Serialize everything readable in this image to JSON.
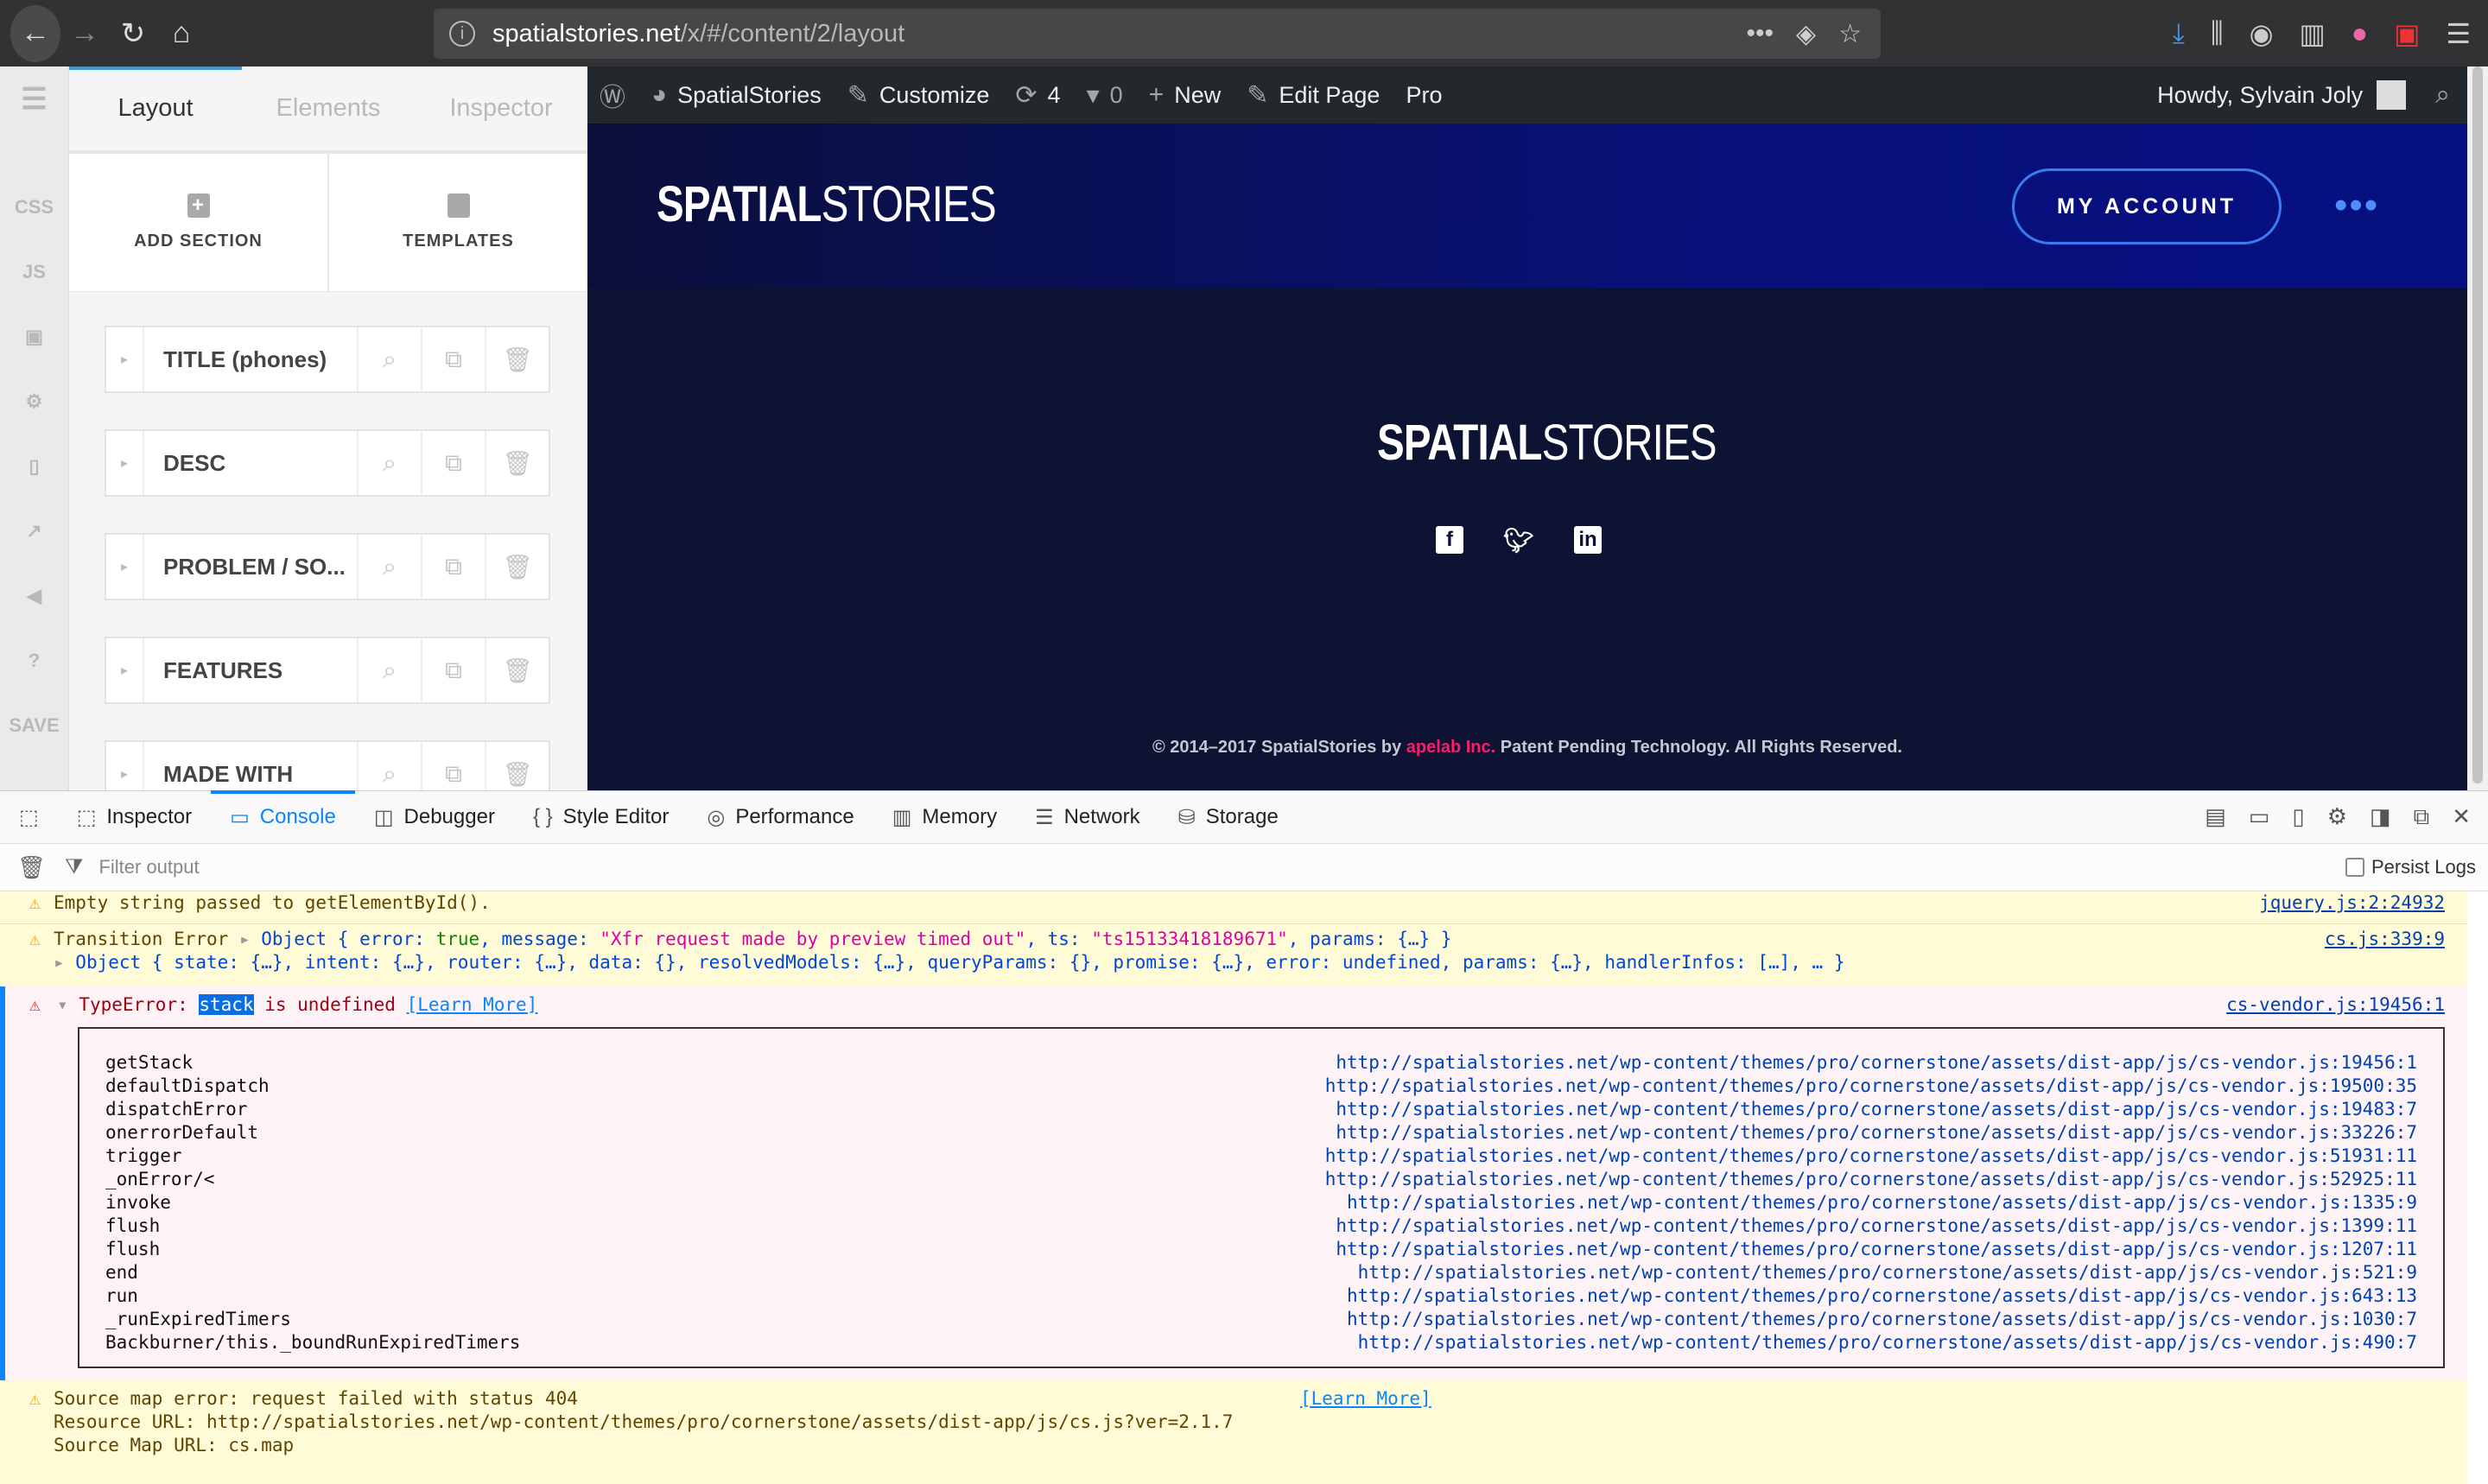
{
  "browser": {
    "url_host": "spatialstories.net",
    "url_path": "/x/#/content/2/layout"
  },
  "rail": {
    "items": [
      "CSS",
      "JS",
      "SAVE"
    ]
  },
  "builder": {
    "tabs": [
      "Layout",
      "Elements",
      "Inspector"
    ],
    "add_section": "ADD SECTION",
    "templates": "TEMPLATES",
    "sections": [
      "TITLE (phones)",
      "DESC",
      "PROBLEM / SO...",
      "FEATURES",
      "MADE WITH"
    ]
  },
  "adminbar": {
    "site": "SpatialStories",
    "customize": "Customize",
    "updates": "4",
    "comments": "0",
    "new": "New",
    "edit": "Edit Page",
    "pro": "Pro",
    "howdy": "Howdy, Sylvain Joly"
  },
  "site": {
    "logo_bold": "SPATIAL",
    "logo_light": "STORIES",
    "my_account": "MY ACCOUNT",
    "copy_pre": "© 2014–2017 SpatialStories by ",
    "copy_link": "apelab Inc.",
    "copy_post": " Patent Pending Technology. All Rights Reserved."
  },
  "devtools": {
    "tabs": [
      "Inspector",
      "Console",
      "Debugger",
      "Style Editor",
      "Performance",
      "Memory",
      "Network",
      "Storage"
    ],
    "filter_placeholder": "Filter output",
    "persist": "Persist Logs"
  },
  "console": {
    "m1": {
      "text": "Empty string passed to getElementById().",
      "src": "jquery.js:2:24932"
    },
    "m2": {
      "label": "Transition Error",
      "obj": "Object { ",
      "k1": "error: ",
      "v1": "true",
      "k2": ", message: ",
      "v2": "\"Xfr request made by preview timed out\"",
      "k3": ", ts: ",
      "v3": "\"ts15133418189671\"",
      "k4": ", params: {…} }",
      "line2": "Object { state: {…}, intent: {…}, router: {…}, data: {}, resolvedModels: {…}, queryParams: {}, promise: {…}, error: undefined, params: {…}, handlerInfos: […], … }",
      "src": "cs.js:339:9"
    },
    "m3": {
      "pre": "TypeError: ",
      "sel": "stack",
      "post": " is undefined ",
      "learn": "[Learn More]",
      "src": "cs-vendor.js:19456:1"
    },
    "stack": [
      {
        "fn": "getStack",
        "url": "http://spatialstories.net/wp-content/themes/pro/cornerstone/assets/dist-app/js/cs-vendor.js:19456:1"
      },
      {
        "fn": "defaultDispatch",
        "url": "http://spatialstories.net/wp-content/themes/pro/cornerstone/assets/dist-app/js/cs-vendor.js:19500:35"
      },
      {
        "fn": "dispatchError",
        "url": "http://spatialstories.net/wp-content/themes/pro/cornerstone/assets/dist-app/js/cs-vendor.js:19483:7"
      },
      {
        "fn": "onerrorDefault",
        "url": "http://spatialstories.net/wp-content/themes/pro/cornerstone/assets/dist-app/js/cs-vendor.js:33226:7"
      },
      {
        "fn": "trigger",
        "url": "http://spatialstories.net/wp-content/themes/pro/cornerstone/assets/dist-app/js/cs-vendor.js:51931:11"
      },
      {
        "fn": "_onError/<",
        "url": "http://spatialstories.net/wp-content/themes/pro/cornerstone/assets/dist-app/js/cs-vendor.js:52925:11"
      },
      {
        "fn": "invoke",
        "url": "http://spatialstories.net/wp-content/themes/pro/cornerstone/assets/dist-app/js/cs-vendor.js:1335:9"
      },
      {
        "fn": "flush",
        "url": "http://spatialstories.net/wp-content/themes/pro/cornerstone/assets/dist-app/js/cs-vendor.js:1399:11"
      },
      {
        "fn": "flush",
        "url": "http://spatialstories.net/wp-content/themes/pro/cornerstone/assets/dist-app/js/cs-vendor.js:1207:11"
      },
      {
        "fn": "end",
        "url": "http://spatialstories.net/wp-content/themes/pro/cornerstone/assets/dist-app/js/cs-vendor.js:521:9"
      },
      {
        "fn": "run",
        "url": "http://spatialstories.net/wp-content/themes/pro/cornerstone/assets/dist-app/js/cs-vendor.js:643:13"
      },
      {
        "fn": "_runExpiredTimers",
        "url": "http://spatialstories.net/wp-content/themes/pro/cornerstone/assets/dist-app/js/cs-vendor.js:1030:7"
      },
      {
        "fn": "Backburner/this._boundRunExpiredTimers",
        "url": "http://spatialstories.net/wp-content/themes/pro/cornerstone/assets/dist-app/js/cs-vendor.js:490:7"
      }
    ],
    "m4": {
      "text": "Source map error: request failed with status 404",
      "learn": "[Learn More]",
      "res": "Resource URL: http://spatialstories.net/wp-content/themes/pro/cornerstone/assets/dist-app/js/cs.js?ver=2.1.7",
      "map": "Source Map URL: cs.map"
    }
  }
}
